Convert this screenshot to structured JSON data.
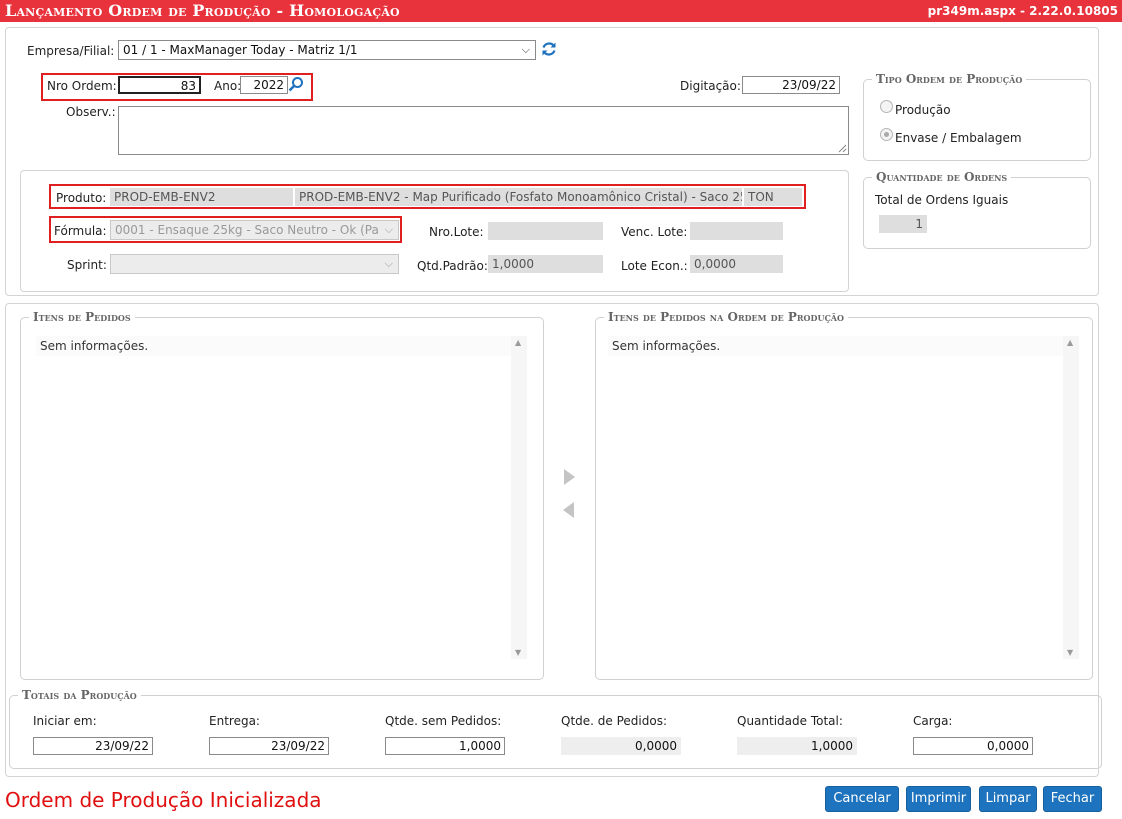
{
  "window": {
    "title": "Lançamento Ordem de Produção  - Homologação",
    "version": "pr349m.aspx - 2.22.0.10805"
  },
  "header": {
    "empresa_label": "Empresa/Filial:",
    "empresa_value": "01 / 1 - MaxManager Today - Matriz 1/1",
    "nro_ordem_label": "Nro Ordem:",
    "nro_ordem_value": "83",
    "ano_label": "Ano:",
    "ano_value": "2022",
    "digitacao_label": "Digitação:",
    "digitacao_value": "23/09/22",
    "observ_label": "Observ.:",
    "observ_value": ""
  },
  "tipo_ordem": {
    "legend": "Tipo Ordem de Produção",
    "options": [
      {
        "label": "Produção",
        "selected": false
      },
      {
        "label": "Envase / Embalagem",
        "selected": true
      }
    ]
  },
  "quantidade_ordens": {
    "legend": "Quantidade de Ordens",
    "label": "Total de Ordens Iguais",
    "value": "1"
  },
  "produto": {
    "produto_label": "Produto:",
    "produto_code": "PROD-EMB-ENV2",
    "produto_desc": "PROD-EMB-ENV2 - Map Purificado (Fosfato Monoamônico Cristal) - Saco 25",
    "produto_unit": "TON",
    "formula_label": "Fórmula:",
    "formula_value": "0001 - Ensaque 25kg - Saco Neutro - Ok (Pa",
    "sprint_label": "Sprint:",
    "sprint_value": "",
    "nro_lote_label": "Nro.Lote:",
    "nro_lote_value": "",
    "qtd_padrao_label": "Qtd.Padrão:",
    "qtd_padrao_value": "1,0000",
    "venc_lote_label": "Venc. Lote:",
    "venc_lote_value": "",
    "lote_econ_label": "Lote Econ.:",
    "lote_econ_value": "0,0000"
  },
  "itens": {
    "left_legend": "Itens de Pedidos",
    "left_empty": "Sem informações.",
    "right_legend": "Itens de Pedidos na Ordem de Produção",
    "right_empty": "Sem informações."
  },
  "totais": {
    "legend": "Totais da Produção",
    "fields": [
      {
        "label": "Iniciar em:",
        "value": "23/09/22"
      },
      {
        "label": "Entrega:",
        "value": "23/09/22"
      },
      {
        "label": "Qtde. sem Pedidos:",
        "value": "1,0000"
      },
      {
        "label": "Qtde. de Pedidos:",
        "value": "0,0000"
      },
      {
        "label": "Quantidade Total:",
        "value": "1,0000"
      },
      {
        "label": "Carga:",
        "value": "0,0000"
      }
    ]
  },
  "status_message": "Ordem de Produção Inicializada",
  "buttons": {
    "cancelar": "Cancelar",
    "imprimir": "Imprimir",
    "limpar": "Limpar",
    "fechar": "Fechar"
  },
  "colors": {
    "title_bar": "#e8323c",
    "button": "#1e73be",
    "status": "#e01010",
    "highlight": "#e02020"
  }
}
